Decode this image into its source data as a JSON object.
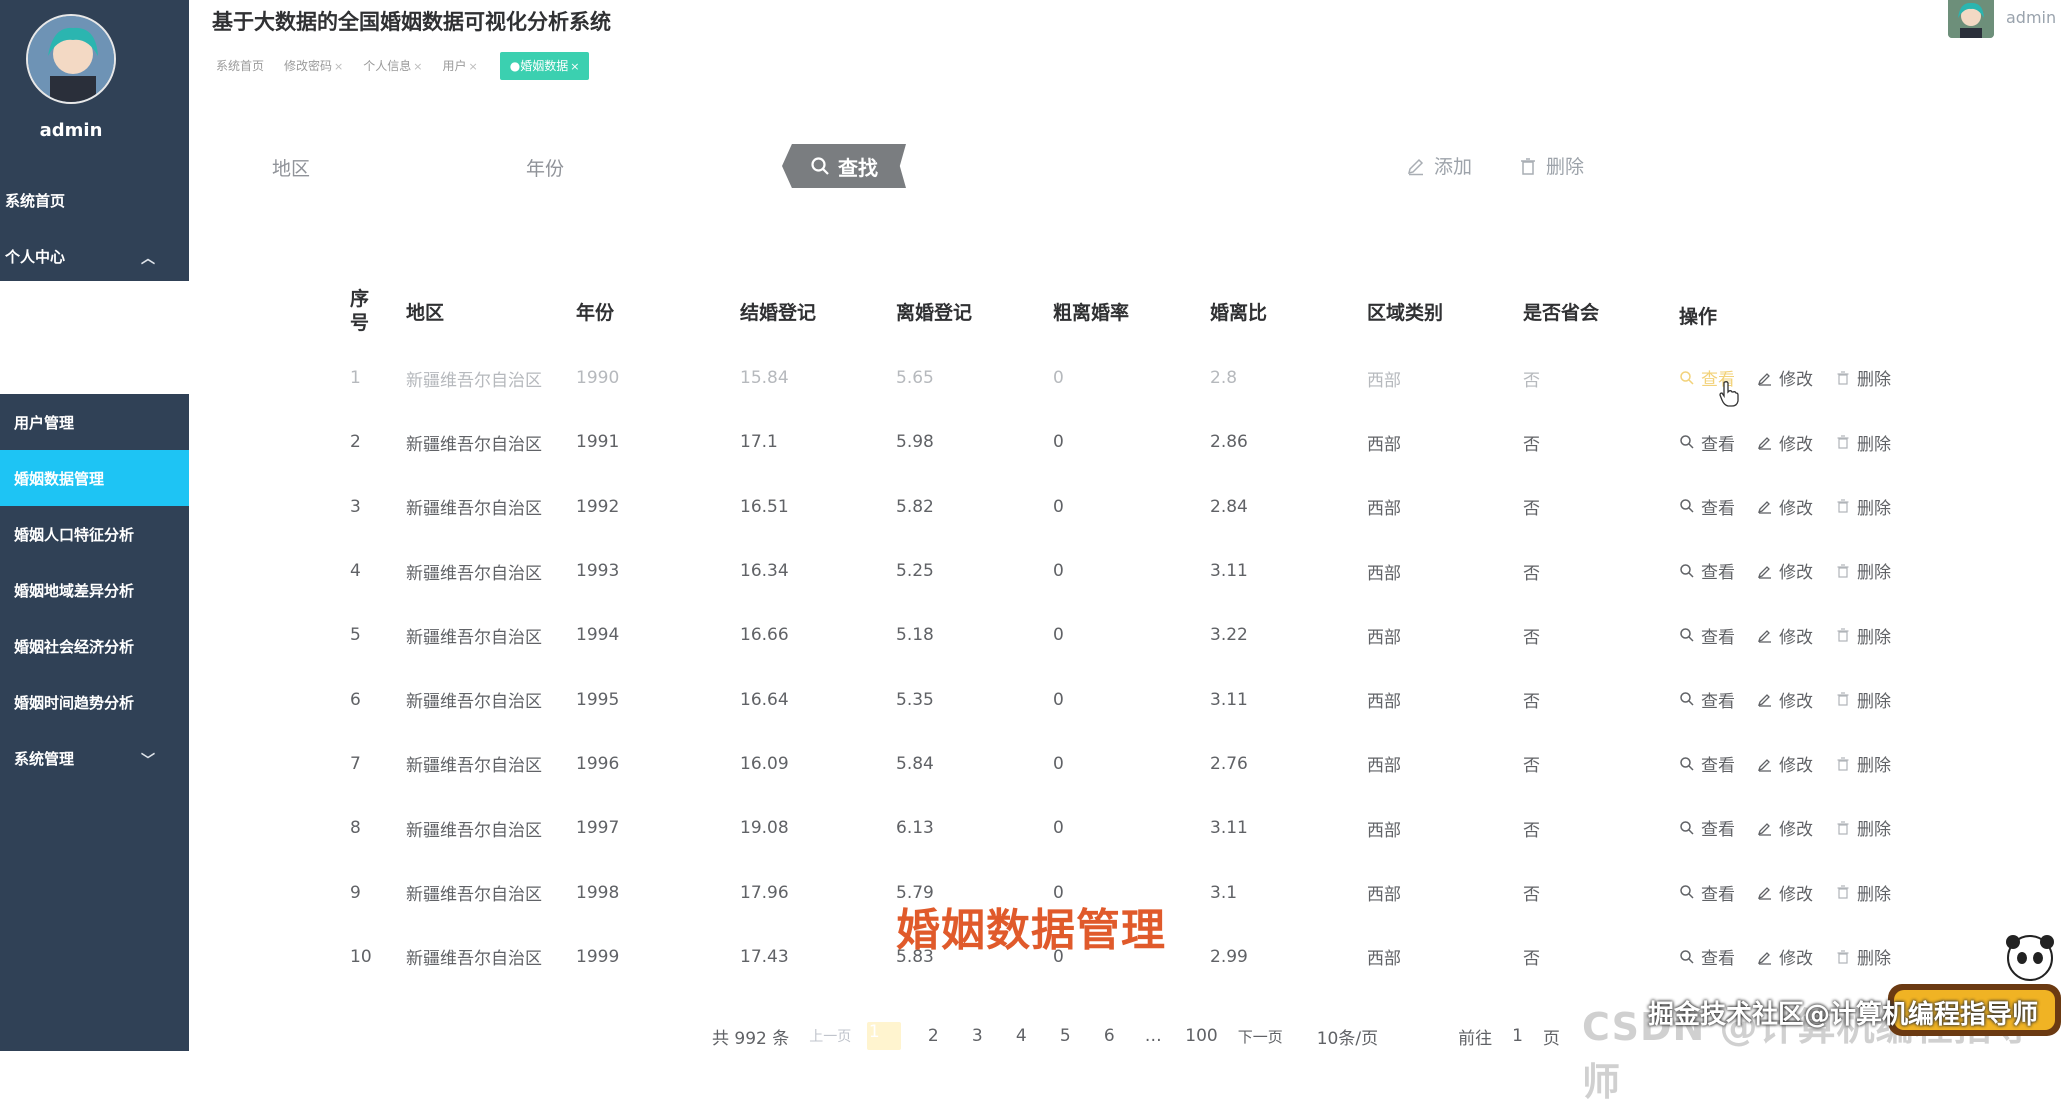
{
  "app": {
    "title": "基于大数据的全国婚姻数据可视化分析系统",
    "header_user": "admin"
  },
  "sidebar": {
    "username": "admin",
    "top_items": [
      {
        "label": "系统首页"
      },
      {
        "label": "个人中心"
      }
    ],
    "items": [
      {
        "label": "用户管理"
      },
      {
        "label": "婚姻数据管理"
      },
      {
        "label": "婚姻人口特征分析"
      },
      {
        "label": "婚姻地域差异分析"
      },
      {
        "label": "婚姻社会经济分析"
      },
      {
        "label": "婚姻时间趋势分析"
      },
      {
        "label": "系统管理"
      }
    ]
  },
  "tabs": [
    {
      "label": "系统首页"
    },
    {
      "label": "修改密码"
    },
    {
      "label": "个人信息"
    },
    {
      "label": "用户"
    },
    {
      "label": "●婚姻数据"
    }
  ],
  "filters": {
    "region_label": "地区",
    "year_label": "年份",
    "search_label": "查找",
    "add_label": "添加",
    "delete_label": "删除"
  },
  "table": {
    "columns": [
      "序号",
      "地区",
      "年份",
      "结婚登记",
      "离婚登记",
      "粗离婚率",
      "婚离比",
      "区域类别",
      "是否省会",
      "操作"
    ],
    "actions": {
      "view": "查看",
      "edit": "修改",
      "delete": "删除"
    },
    "rows": [
      [
        "1",
        "新疆维吾尔自治区",
        "1990",
        "15.84",
        "5.65",
        "0",
        "2.8",
        "西部",
        "否"
      ],
      [
        "2",
        "新疆维吾尔自治区",
        "1991",
        "17.1",
        "5.98",
        "0",
        "2.86",
        "西部",
        "否"
      ],
      [
        "3",
        "新疆维吾尔自治区",
        "1992",
        "16.51",
        "5.82",
        "0",
        "2.84",
        "西部",
        "否"
      ],
      [
        "4",
        "新疆维吾尔自治区",
        "1993",
        "16.34",
        "5.25",
        "0",
        "3.11",
        "西部",
        "否"
      ],
      [
        "5",
        "新疆维吾尔自治区",
        "1994",
        "16.66",
        "5.18",
        "0",
        "3.22",
        "西部",
        "否"
      ],
      [
        "6",
        "新疆维吾尔自治区",
        "1995",
        "16.64",
        "5.35",
        "0",
        "3.11",
        "西部",
        "否"
      ],
      [
        "7",
        "新疆维吾尔自治区",
        "1996",
        "16.09",
        "5.84",
        "0",
        "2.76",
        "西部",
        "否"
      ],
      [
        "8",
        "新疆维吾尔自治区",
        "1997",
        "19.08",
        "6.13",
        "0",
        "3.11",
        "西部",
        "否"
      ],
      [
        "9",
        "新疆维吾尔自治区",
        "1998",
        "17.96",
        "5.79",
        "0",
        "3.1",
        "西部",
        "否"
      ],
      [
        "10",
        "新疆维吾尔自治区",
        "1999",
        "17.43",
        "5.83",
        "0",
        "2.99",
        "西部",
        "否"
      ]
    ]
  },
  "pagination": {
    "total": "共 992 条",
    "prev": "上一页",
    "pages": [
      "1",
      "2",
      "3",
      "4",
      "5",
      "6",
      "…",
      "100"
    ],
    "next": "下一页",
    "page_size": "10条/页",
    "goto_prefix": "前往",
    "goto_value": "1",
    "goto_suffix": "页"
  },
  "overlay": {
    "caption": "婚姻数据管理",
    "watermark_main": "掘金技术社区@计算机编程指导师",
    "watermark_csdn": "CSDN @计算机编程指导师"
  }
}
